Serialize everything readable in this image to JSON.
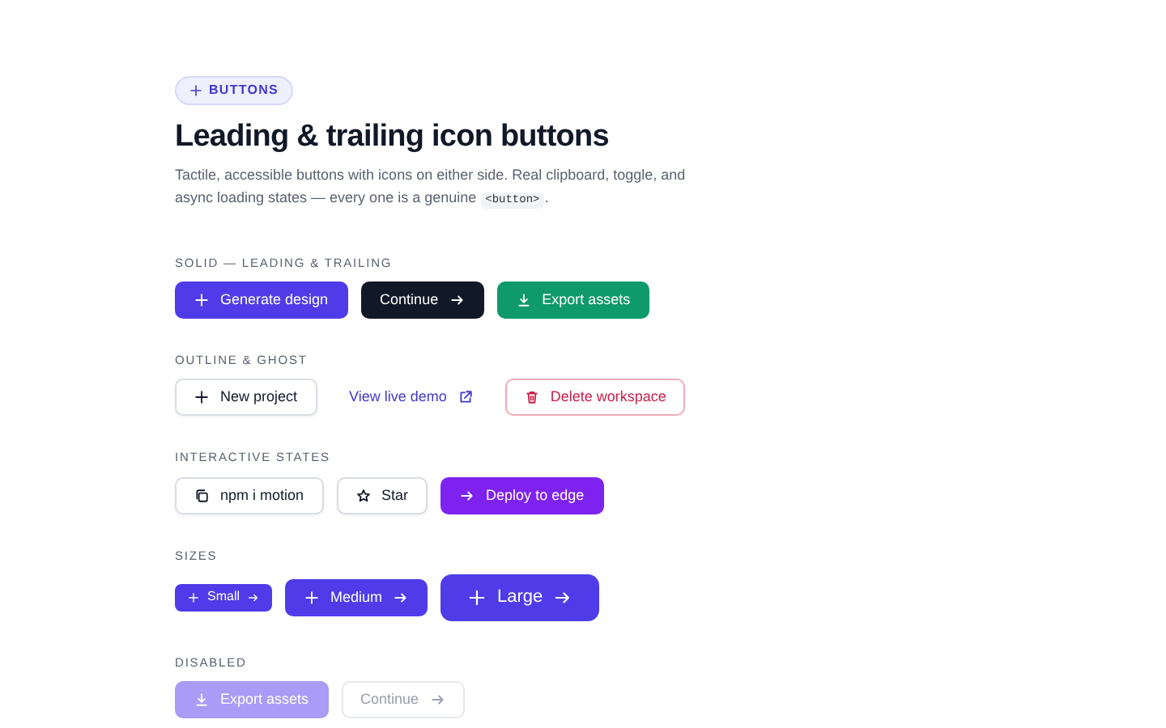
{
  "badge": {
    "label": "BUTTONS"
  },
  "title": "Leading & trailing icon buttons",
  "description": {
    "text": "Tactile, accessible buttons with icons on either side. Real clipboard, toggle, and async loading states — every one is a genuine ",
    "code": "<button>",
    "end": "."
  },
  "sections": [
    {
      "label": "SOLID — LEADING & TRAILING",
      "buttons": [
        {
          "label": "Generate design",
          "kind": "primary",
          "size": {
            "kind": "md"
          },
          "leading": {
            "kind": "plus"
          },
          "disabled": false
        },
        {
          "label": "Continue",
          "kind": "dark",
          "size": {
            "kind": "md"
          },
          "trailing": {
            "kind": "arrow"
          },
          "disabled": false
        },
        {
          "label": "Export assets",
          "kind": "success",
          "size": {
            "kind": "md"
          },
          "leading": {
            "kind": "download"
          },
          "disabled": false
        }
      ]
    },
    {
      "label": "OUTLINE & GHOST",
      "buttons": [
        {
          "label": "New project",
          "kind": "outline",
          "size": {
            "kind": "md"
          },
          "leading": {
            "kind": "plus"
          },
          "disabled": false
        },
        {
          "label": "View live demo",
          "kind": "ghost",
          "size": {
            "kind": "md"
          },
          "trailing": {
            "kind": "external"
          },
          "disabled": false
        },
        {
          "label": "Delete workspace",
          "kind": "danger",
          "size": {
            "kind": "md"
          },
          "leading": {
            "kind": "trash"
          },
          "disabled": false
        }
      ]
    },
    {
      "label": "INTERACTIVE STATES",
      "buttons": [
        {
          "label": "npm i motion",
          "kind": "outline",
          "size": {
            "kind": "md"
          },
          "leading": {
            "kind": "copy"
          },
          "disabled": false
        },
        {
          "label": "Star",
          "kind": "outline",
          "size": {
            "kind": "md"
          },
          "leading": {
            "kind": "star"
          },
          "disabled": false
        },
        {
          "label": "Deploy to edge",
          "kind": "violet",
          "size": {
            "kind": "md"
          },
          "leading": {
            "kind": "arrow"
          },
          "disabled": false
        }
      ]
    },
    {
      "label": "SIZES",
      "buttons": [
        {
          "label": "Small",
          "kind": "primary",
          "size": {
            "kind": "sm"
          },
          "leading": {
            "kind": "plus"
          },
          "trailing": {
            "kind": "arrow"
          },
          "disabled": false
        },
        {
          "label": "Medium",
          "kind": "primary",
          "size": {
            "kind": "md"
          },
          "leading": {
            "kind": "plus"
          },
          "trailing": {
            "kind": "arrow"
          },
          "disabled": false
        },
        {
          "label": "Large",
          "kind": "primary",
          "size": {
            "kind": "lg"
          },
          "leading": {
            "kind": "plus"
          },
          "trailing": {
            "kind": "arrow"
          },
          "disabled": false
        }
      ]
    },
    {
      "label": "DISABLED",
      "buttons": [
        {
          "label": "Export assets",
          "kind": "primary",
          "size": {
            "kind": "md"
          },
          "leading": {
            "kind": "download"
          },
          "disabled": true
        },
        {
          "label": "Continue",
          "kind": "outline",
          "size": {
            "kind": "md"
          },
          "trailing": {
            "kind": "arrow"
          },
          "disabled": true
        }
      ]
    }
  ]
}
